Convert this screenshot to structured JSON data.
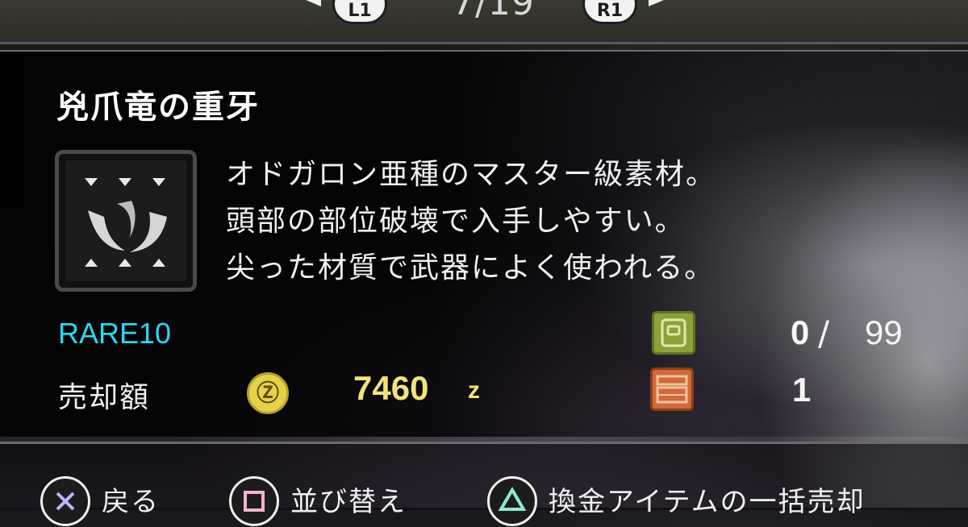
{
  "pager": {
    "left_button": "L1",
    "right_button": "R1",
    "page": "7/19"
  },
  "item": {
    "name": "兇爪竜の重牙",
    "icon": "fang-material-icon",
    "description": [
      "オドガロン亜種のマスター級素材。",
      "頭部の部位破壊で入手しやすい。",
      "尖った材質で武器によく使われる。"
    ],
    "rarity": "RARE10",
    "sell_label": "売却額",
    "sell_price": "7460",
    "currency_unit": "z",
    "currency_icon_glyph": "Ⓩ",
    "pouch_count": "0",
    "pouch_max": "99",
    "box_count": "1"
  },
  "colors": {
    "rarity": "#27d9f2",
    "price": "#f2e27a",
    "pouch_icon": "#8aa238",
    "box_icon": "#d06a38"
  },
  "footer": {
    "back": {
      "icon": "cross-button-icon",
      "label": "戻る"
    },
    "sort": {
      "icon": "square-button-icon",
      "label": "並び替え"
    },
    "sell_all": {
      "icon": "triangle-button-icon",
      "label": "換金アイテムの一括売却"
    }
  }
}
